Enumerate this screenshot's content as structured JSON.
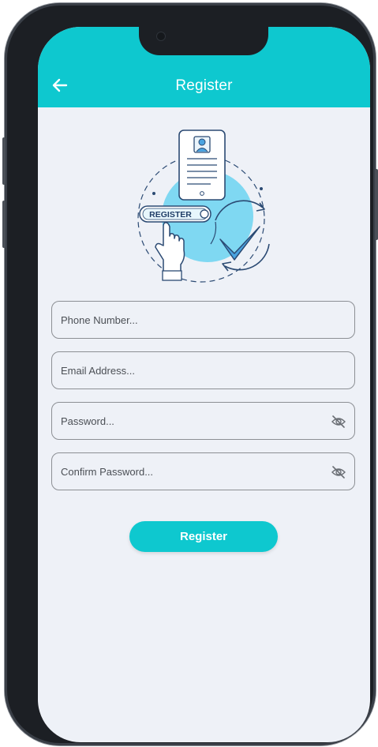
{
  "header": {
    "title": "Register",
    "back_icon": "arrow-left-icon"
  },
  "illustration": {
    "badge_text": "REGISTER",
    "icons": [
      "phone-id-card-icon",
      "hand-pointer-icon",
      "checkmark-icon",
      "refresh-arrows-icon"
    ]
  },
  "form": {
    "phone": {
      "placeholder": "Phone Number...",
      "value": ""
    },
    "email": {
      "placeholder": "Email Address...",
      "value": ""
    },
    "password": {
      "placeholder": "Password...",
      "value": "",
      "toggle_icon": "eye-off-icon"
    },
    "confirm_password": {
      "placeholder": "Confirm Password...",
      "value": "",
      "toggle_icon": "eye-off-icon"
    }
  },
  "actions": {
    "register_label": "Register"
  },
  "colors": {
    "accent": "#0ec8cf",
    "background": "#eef1f7",
    "field_border": "#8c8f94",
    "illustration_blue": "#7fd8f2"
  }
}
